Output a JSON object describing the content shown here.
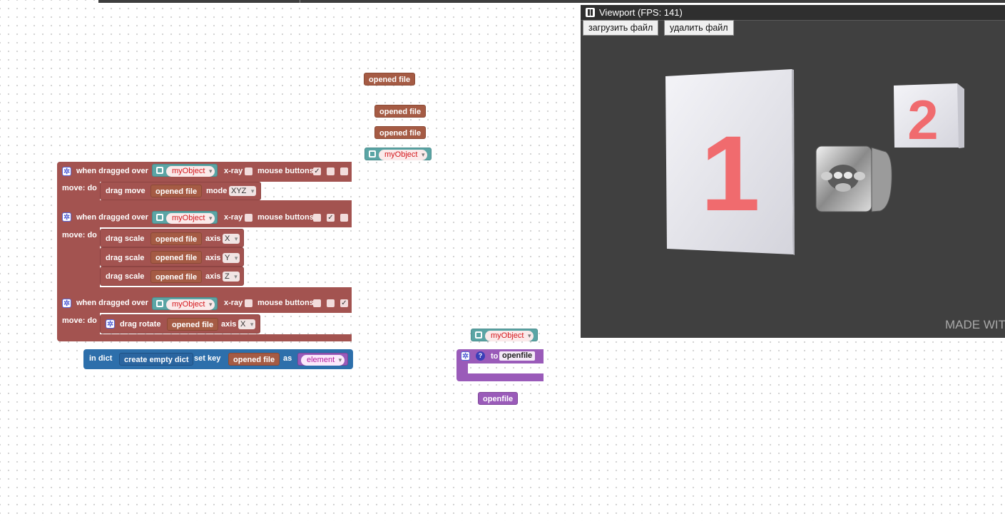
{
  "viewport": {
    "title": "Viewport (FPS: 141)",
    "load_button": "загрузить файл",
    "delete_button": "удалить файл",
    "watermark": "MADE WIT",
    "scene_labels": [
      "1",
      "2"
    ]
  },
  "floating": {
    "opened_file_1": "opened file",
    "opened_file_2": "opened file",
    "opened_file_3": "opened file",
    "my_object_1": "myObject",
    "my_object_2": "myObject",
    "openfile_var": "openfile"
  },
  "block1": {
    "event_label": "when dragged over",
    "object": "myObject",
    "xray_label": "x-ray",
    "mouse_label": "mouse buttons:",
    "do_label": "move: do",
    "action_label": "drag move",
    "file": "opened file",
    "param_label": "mode",
    "param_value": "XYZ",
    "checks": [
      "✓",
      "",
      ""
    ]
  },
  "block2": {
    "event_label": "when dragged over",
    "object": "myObject",
    "xray_label": "x-ray",
    "mouse_label": "mouse buttons:",
    "do_label": "move: do",
    "checks": [
      "",
      "✓",
      ""
    ],
    "actions": [
      {
        "label": "drag scale",
        "file": "opened file",
        "param_label": "axis",
        "param_value": "X"
      },
      {
        "label": "drag scale",
        "file": "opened file",
        "param_label": "axis",
        "param_value": "Y"
      },
      {
        "label": "drag scale",
        "file": "opened file",
        "param_label": "axis",
        "param_value": "Z"
      }
    ]
  },
  "block3": {
    "event_label": "when dragged over",
    "object": "myObject",
    "xray_label": "x-ray",
    "mouse_label": "mouse buttons:",
    "do_label": "move: do",
    "checks": [
      "",
      "",
      "✓"
    ],
    "action_label": "drag rotate",
    "file": "opened file",
    "param_label": "axis",
    "param_value": "X"
  },
  "dict_block": {
    "in_label": "in dict",
    "create_label": "create empty dict",
    "setkey_label": "set key",
    "file": "opened file",
    "as_label": "as",
    "element": "element"
  },
  "proc_block": {
    "help": "?",
    "to_label": "to",
    "name": "openfile"
  },
  "colors": {
    "event_block": "#a35350",
    "file_var": "#a55b44",
    "object_var": "#5ba5a5",
    "procedure": "#9a5bb9",
    "dict": "#2d6fab",
    "viewport_bg": "#404040"
  }
}
